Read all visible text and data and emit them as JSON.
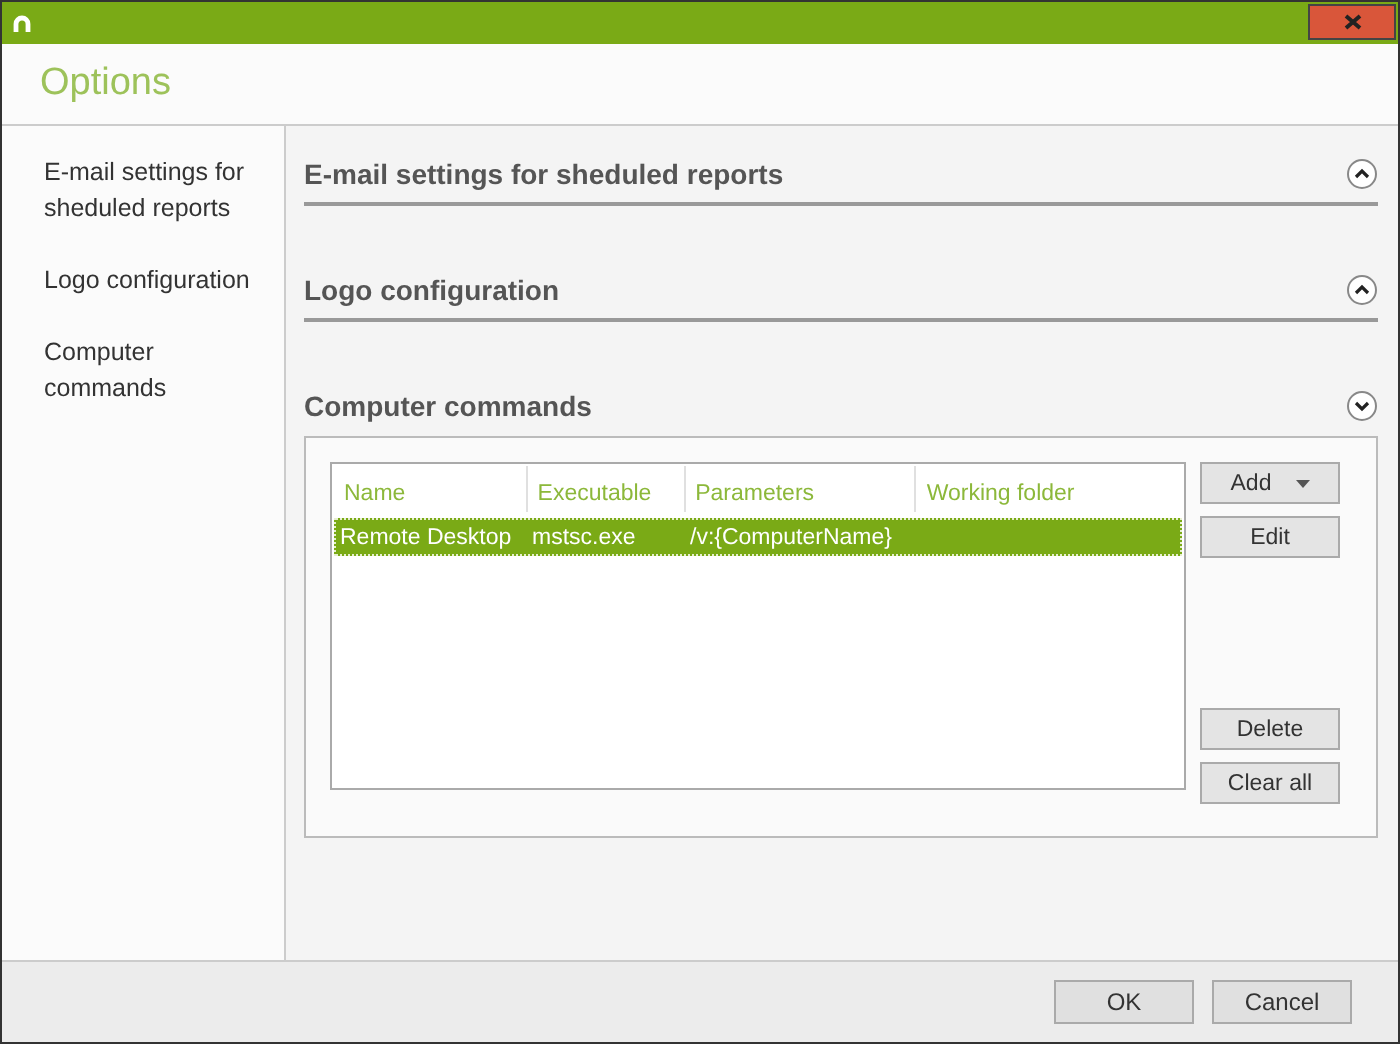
{
  "window": {
    "title": "Options"
  },
  "sidebar": {
    "items": [
      {
        "label": "E-mail settings for sheduled reports",
        "selected": false
      },
      {
        "label": "Logo configuration",
        "selected": false
      },
      {
        "label": "Computer commands",
        "selected": false
      }
    ]
  },
  "sections": [
    {
      "title": "E-mail settings for sheduled reports",
      "expanded": false
    },
    {
      "title": "Logo configuration",
      "expanded": false
    },
    {
      "title": "Computer commands",
      "expanded": true
    }
  ],
  "table": {
    "columns": [
      "Name",
      "Executable",
      "Parameters",
      "Working folder"
    ],
    "rows": [
      {
        "cells": [
          "Remote Desktop",
          "mstsc.exe",
          "/v:{ComputerName}",
          ""
        ],
        "selected": true
      }
    ]
  },
  "side_buttons": [
    {
      "label": "Add",
      "kind": "dropdown"
    },
    {
      "label": "Edit",
      "kind": "plain"
    },
    {
      "label": "Delete",
      "kind": "plain"
    },
    {
      "label": "Clear all",
      "kind": "plain"
    }
  ],
  "buttons": [
    "OK",
    "Cancel"
  ]
}
